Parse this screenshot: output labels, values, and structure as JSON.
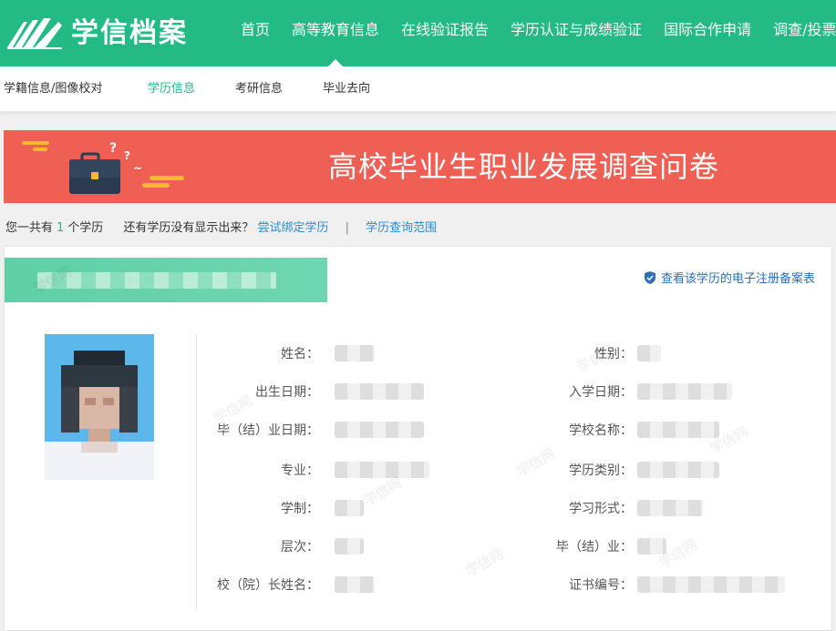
{
  "header": {
    "logo_text": "学信档案",
    "nav": [
      {
        "label": "首页",
        "active": false
      },
      {
        "label": "高等教育信息",
        "active": true
      },
      {
        "label": "在线验证报告",
        "active": false
      },
      {
        "label": "学历认证与成绩验证",
        "active": false
      },
      {
        "label": "国际合作申请",
        "active": false
      },
      {
        "label": "调查/投票",
        "active": false
      }
    ]
  },
  "subnav": [
    {
      "label": "学籍信息/图像校对",
      "active": false
    },
    {
      "label": "学历信息",
      "active": true
    },
    {
      "label": "考研信息",
      "active": false
    },
    {
      "label": "毕业去向",
      "active": false
    }
  ],
  "banner": {
    "text": "高校毕业生职业发展调查问卷"
  },
  "summary": {
    "prefix": "您一共有",
    "count": "1",
    "suffix": "个学历",
    "question": "还有学历没有显示出来？",
    "bind_link": "尝试绑定学历",
    "separator": "|",
    "range_link": "学历查询范围"
  },
  "record": {
    "verify_link": "查看该学历的电子注册备案表",
    "left_fields": [
      {
        "label": "姓名："
      },
      {
        "label": "出生日期："
      },
      {
        "label": "毕（结）业日期："
      },
      {
        "label": "专业："
      },
      {
        "label": "学制："
      },
      {
        "label": "层次："
      },
      {
        "label": "校（院）长姓名："
      }
    ],
    "right_fields": [
      {
        "label": "性别："
      },
      {
        "label": "入学日期："
      },
      {
        "label": "学校名称："
      },
      {
        "label": "学历类别："
      },
      {
        "label": "学习形式："
      },
      {
        "label": "毕（结）业："
      },
      {
        "label": "证书编号："
      }
    ]
  },
  "watermark": "学信网",
  "colors": {
    "brand": "#24ba86",
    "banner": "#ef5f54",
    "link": "#2a8bd1"
  }
}
